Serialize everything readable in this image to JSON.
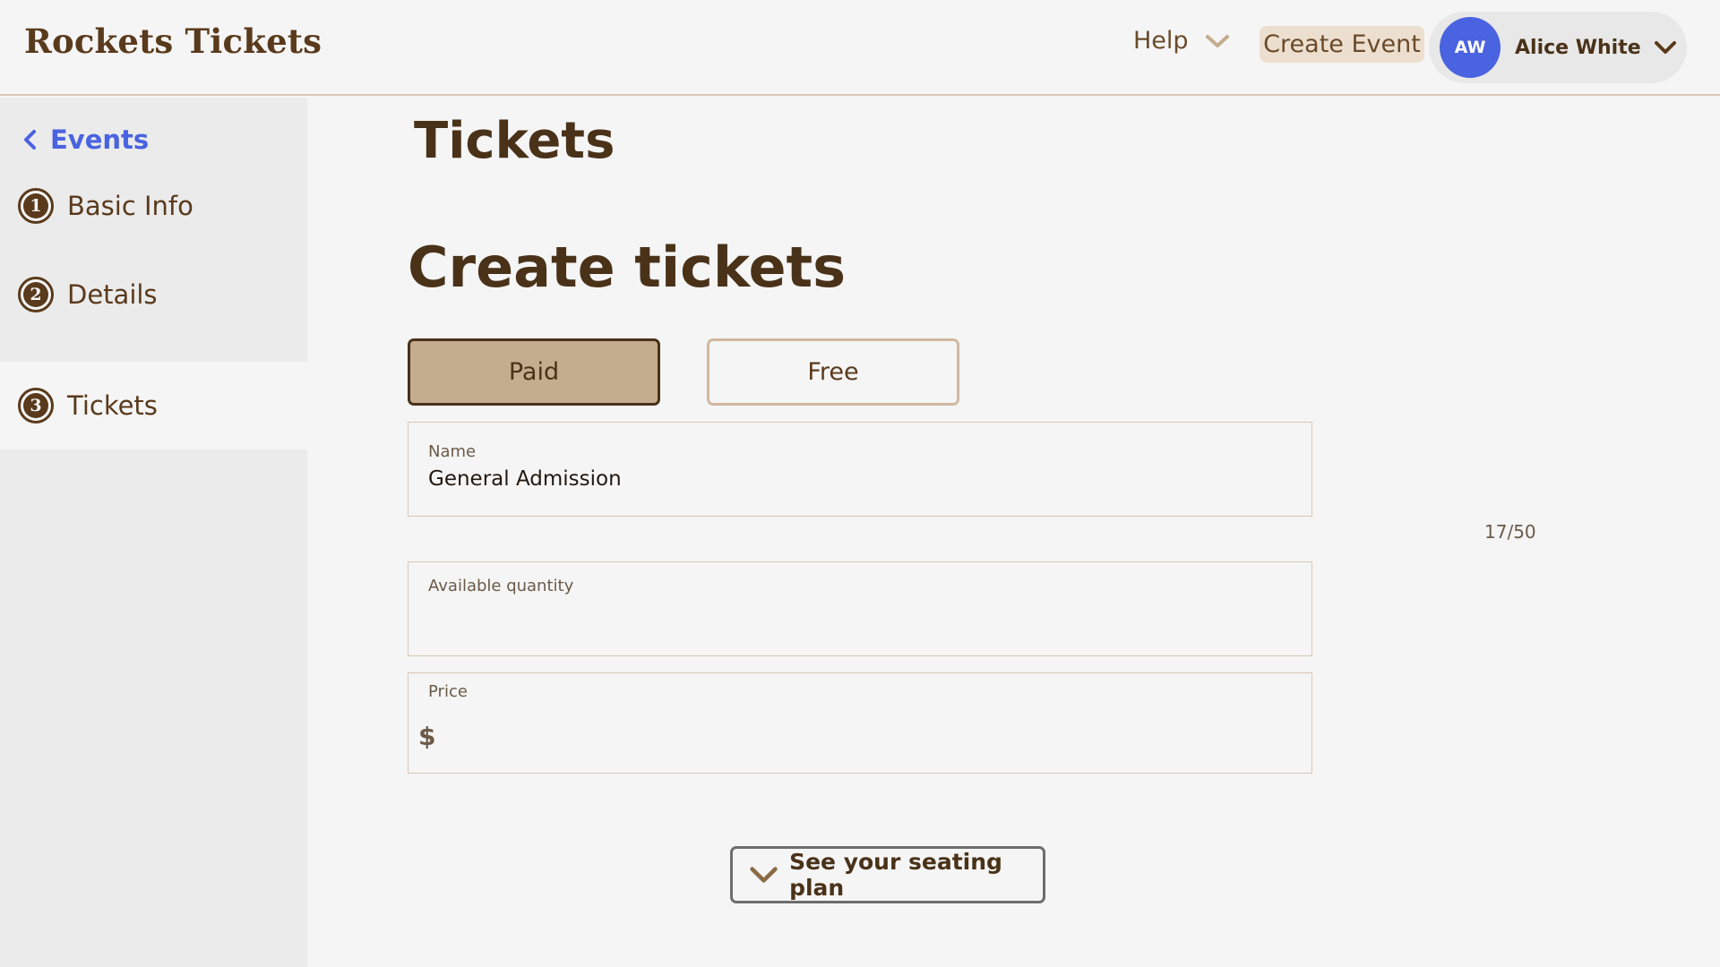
{
  "header": {
    "brand": "Rockets Tickets",
    "help_label": "Help",
    "create_event_label": "Create Event",
    "user": {
      "initials": "AW",
      "name": "Alice White",
      "avatar_color": "#4a63e0"
    }
  },
  "sidebar": {
    "back_label": "Events",
    "steps": [
      {
        "number": "1",
        "label": "Basic Info",
        "active": false
      },
      {
        "number": "2",
        "label": "Details",
        "active": false
      },
      {
        "number": "3",
        "label": "Tickets",
        "active": true
      }
    ]
  },
  "main": {
    "page_title": "Tickets",
    "section_title": "Create tickets",
    "ticket_type": {
      "options": [
        "Paid",
        "Free"
      ],
      "selected": "Paid"
    },
    "fields": {
      "name": {
        "label": "Name",
        "value": "General Admission",
        "counter": "17/50"
      },
      "quantity": {
        "label": "Available quantity",
        "value": ""
      },
      "price": {
        "label": "Price",
        "currency_symbol": "$",
        "value": ""
      }
    },
    "seating_plan_label": "See your seating plan"
  },
  "colors": {
    "accent_blue": "#4a63e0",
    "brown_text": "#4a3219",
    "paid_fill": "#c4ac8f",
    "create_event_bg": "#ecdfcf"
  },
  "icons": {
    "help": "chevron-down-icon",
    "user": "chevron-down-icon",
    "back": "chevron-left-icon",
    "seating": "chevron-down-icon"
  }
}
